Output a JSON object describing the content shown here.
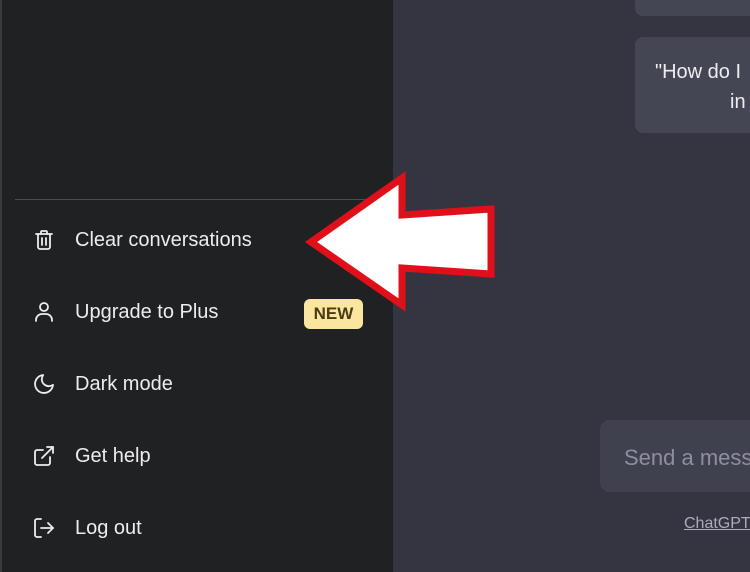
{
  "menu": {
    "items": [
      {
        "label": "Clear conversations",
        "icon": "trash-icon"
      },
      {
        "label": "Upgrade to Plus",
        "icon": "user-icon",
        "badge": "NEW"
      },
      {
        "label": "Dark mode",
        "icon": "moon-icon"
      },
      {
        "label": "Get help",
        "icon": "external-link-icon"
      },
      {
        "label": "Log out",
        "icon": "logout-icon"
      }
    ]
  },
  "chat": {
    "message_line1": "\"How do I",
    "message_line2": "in"
  },
  "composer": {
    "placeholder": "Send a mess"
  },
  "footer": {
    "link": "ChatGPT"
  },
  "colors": {
    "sidebar_bg": "#202123",
    "main_bg": "#343541",
    "badge_bg": "#fae69e",
    "arrow_stroke": "#e0101b",
    "arrow_fill": "#ffffff"
  }
}
